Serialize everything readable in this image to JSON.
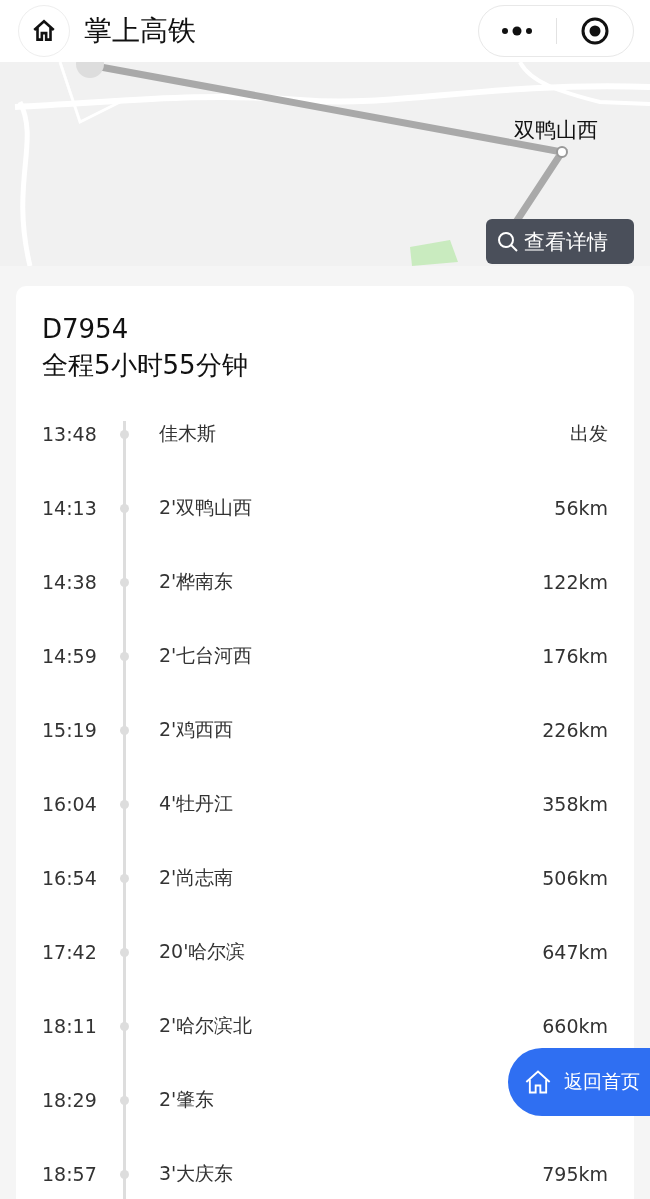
{
  "title_bar": {
    "title": "掌上高铁"
  },
  "map": {
    "kind": "picture",
    "station_label": "双鸭山西",
    "details_button": "查看详情"
  },
  "train": {
    "number": "D7954",
    "duration": "全程5小时55分钟"
  },
  "stops": [
    {
      "time": "13:48",
      "station": "佳木斯",
      "distance": "出发"
    },
    {
      "time": "14:13",
      "station": "2'双鸭山西",
      "distance": "56km"
    },
    {
      "time": "14:38",
      "station": "2'桦南东",
      "distance": "122km"
    },
    {
      "time": "14:59",
      "station": "2'七台河西",
      "distance": "176km"
    },
    {
      "time": "15:19",
      "station": "2'鸡西西",
      "distance": "226km"
    },
    {
      "time": "16:04",
      "station": "4'牡丹江",
      "distance": "358km"
    },
    {
      "time": "16:54",
      "station": "2'尚志南",
      "distance": "506km"
    },
    {
      "time": "17:42",
      "station": "20'哈尔滨",
      "distance": "647km"
    },
    {
      "time": "18:11",
      "station": "2'哈尔滨北",
      "distance": "660km"
    },
    {
      "time": "18:29",
      "station": "2'肇东"
    },
    {
      "time": "18:57",
      "station": "3'大庆东",
      "distance": "795km"
    }
  ],
  "home_button": {
    "label": "返回首页"
  }
}
